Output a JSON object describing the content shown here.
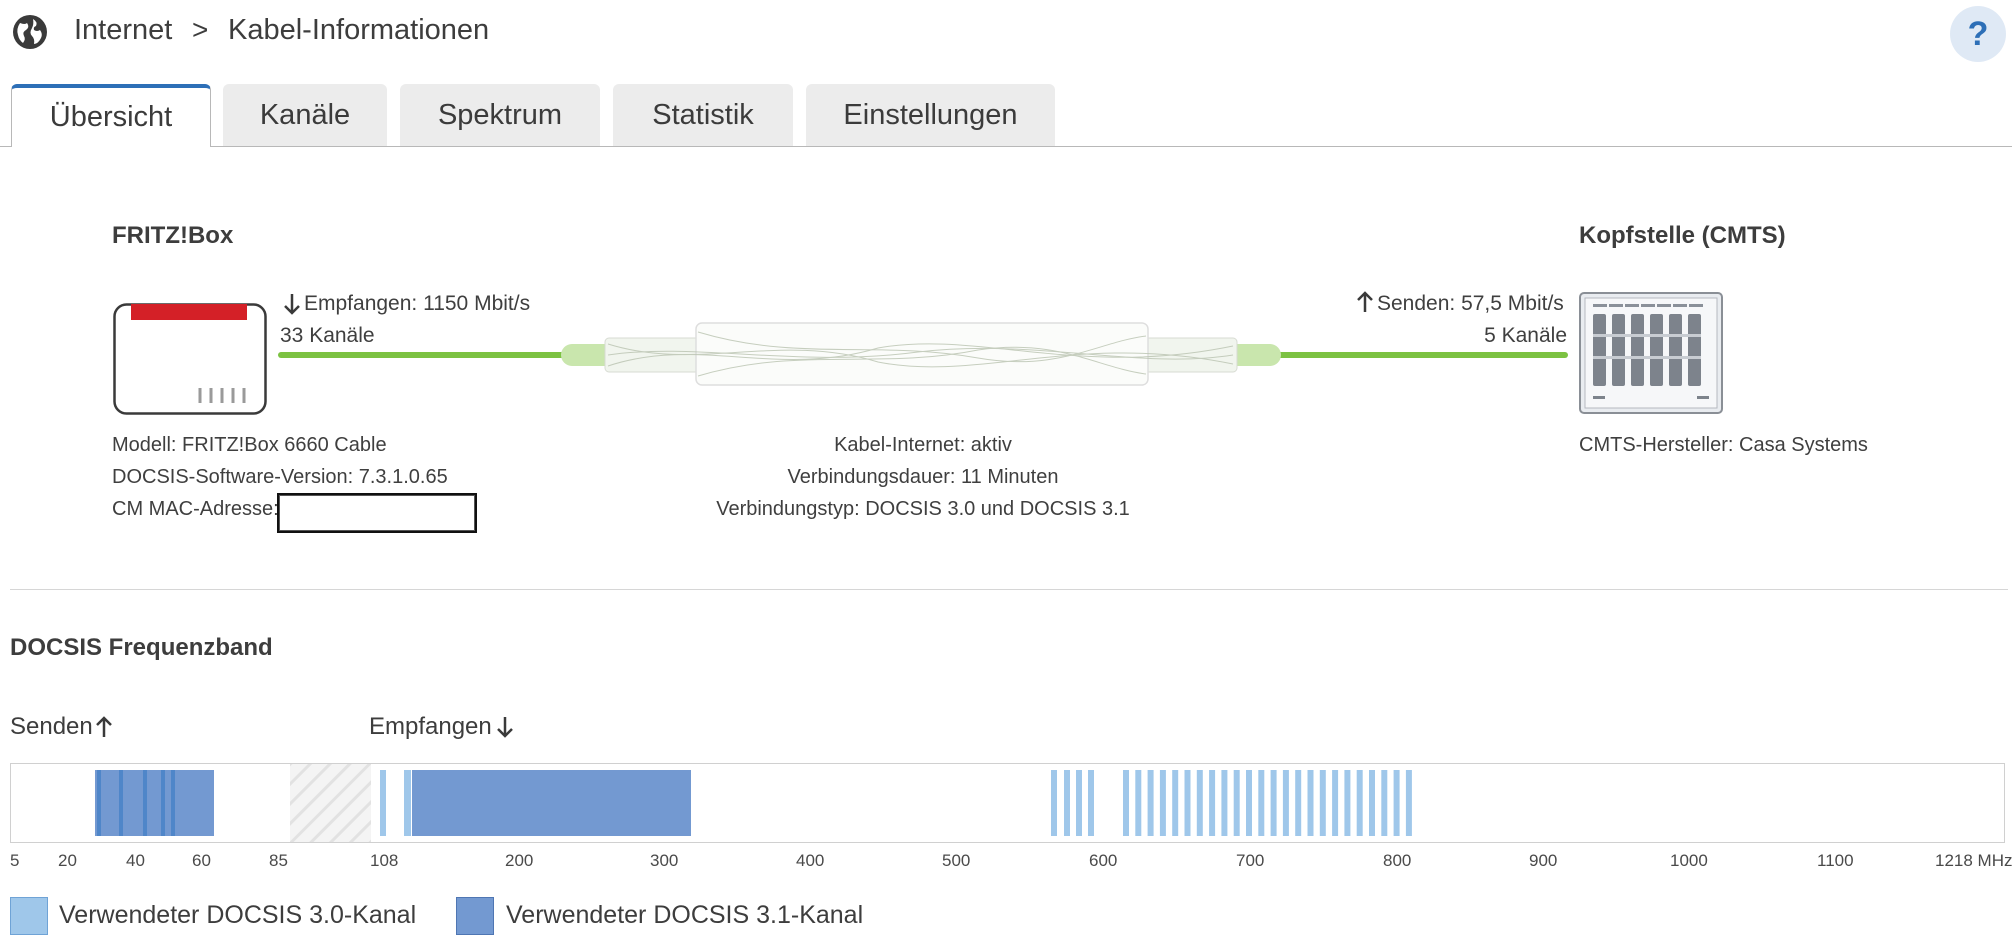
{
  "header": {
    "section": "Internet",
    "separator": ">",
    "page": "Kabel-Informationen",
    "help": "?"
  },
  "tabs": [
    {
      "label": "Übersicht",
      "active": true
    },
    {
      "label": "Kanäle",
      "active": false
    },
    {
      "label": "Spektrum",
      "active": false
    },
    {
      "label": "Statistik",
      "active": false
    },
    {
      "label": "Einstellungen",
      "active": false
    }
  ],
  "fritzbox": {
    "title": "FRITZ!Box",
    "model": "Modell: FRITZ!Box 6660 Cable",
    "docsis_version": "DOCSIS-Software-Version: 7.3.1.0.65",
    "mac_label": "CM MAC-Adresse:"
  },
  "downstream": {
    "label": "Empfangen: 1150 Mbit/s",
    "channels": "33 Kanäle"
  },
  "upstream": {
    "label": "Senden: 57,5 Mbit/s",
    "channels": "5 Kanäle"
  },
  "connection": {
    "status": "Kabel-Internet: aktiv",
    "duration": "Verbindungsdauer: 11 Minuten",
    "type": "Verbindungstyp: DOCSIS 3.0 und DOCSIS 3.1"
  },
  "cmts": {
    "title": "Kopfstelle (CMTS)",
    "manufacturer": "CMTS-Hersteller: Casa Systems"
  },
  "band": {
    "title": "DOCSIS Frequenzband",
    "send_label": "Senden",
    "receive_label": "Empfangen",
    "ticks": [
      "5",
      "20",
      "40",
      "60",
      "85",
      "108",
      "200",
      "300",
      "400",
      "500",
      "600",
      "700",
      "800",
      "900",
      "1000",
      "1100",
      "1218 MHz"
    ],
    "legend": [
      {
        "label": "Verwendeter DOCSIS 3.0-Kanal",
        "color": "#9fc7ea"
      },
      {
        "label": "Verwendeter DOCSIS 3.1-Kanal",
        "color": "#7399d1"
      }
    ]
  },
  "colors": {
    "accent": "#2d6fb7",
    "line_green": "#7cc242",
    "docsis30": "#9fc7ea",
    "docsis31": "#7399d1"
  },
  "icons": {
    "globe": "globe-icon",
    "help": "help-icon",
    "down_arrow": "arrow-down-icon",
    "up_arrow": "arrow-up-icon"
  }
}
